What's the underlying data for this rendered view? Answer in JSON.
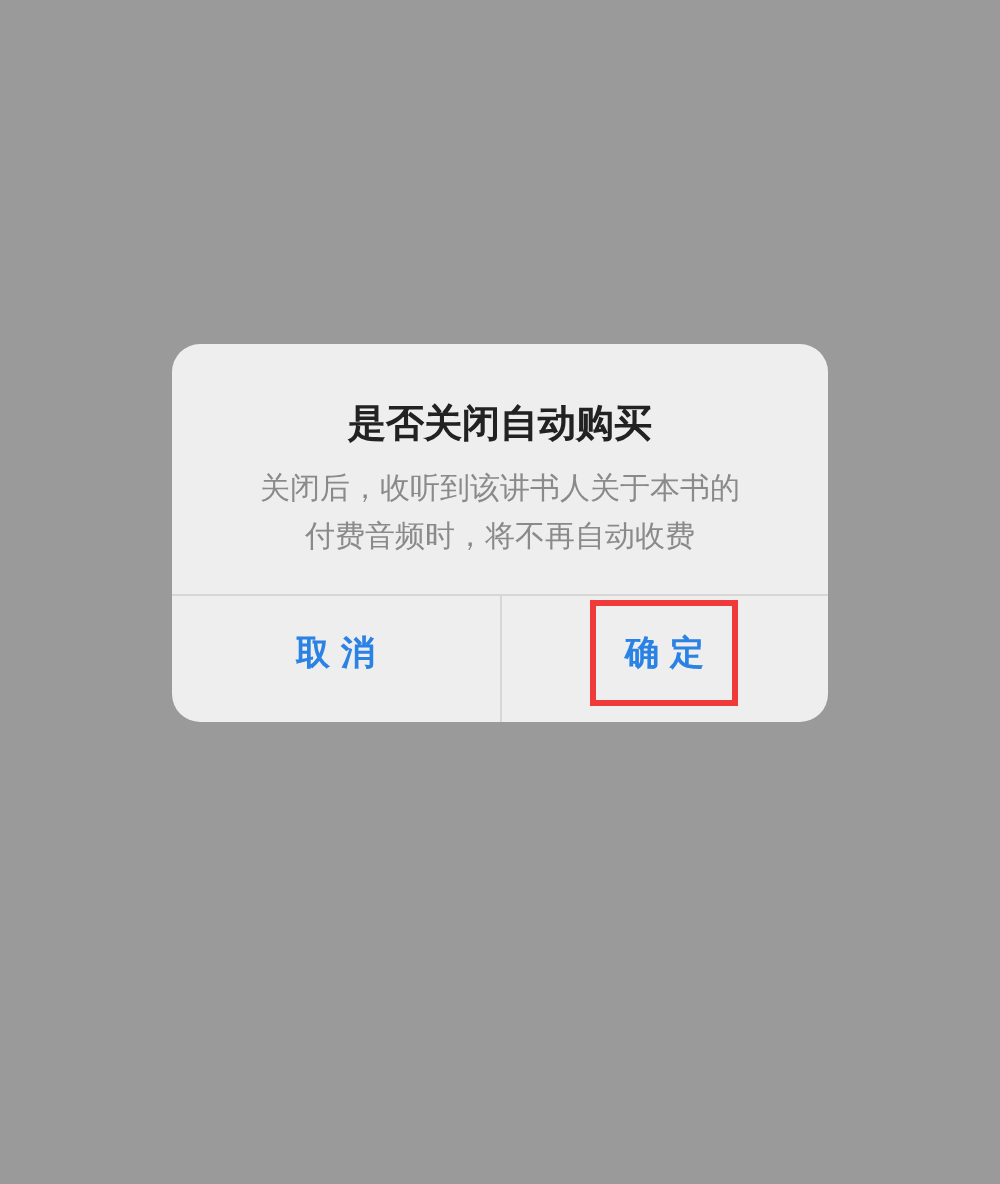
{
  "dialog": {
    "title": "是否关闭自动购买",
    "message": "关闭后，收听到该讲书人关于本书的付费音频时，将不再自动收费",
    "buttons": [
      {
        "label": "取 消",
        "highlighted": false
      },
      {
        "label": "确 定",
        "highlighted": true
      }
    ]
  }
}
